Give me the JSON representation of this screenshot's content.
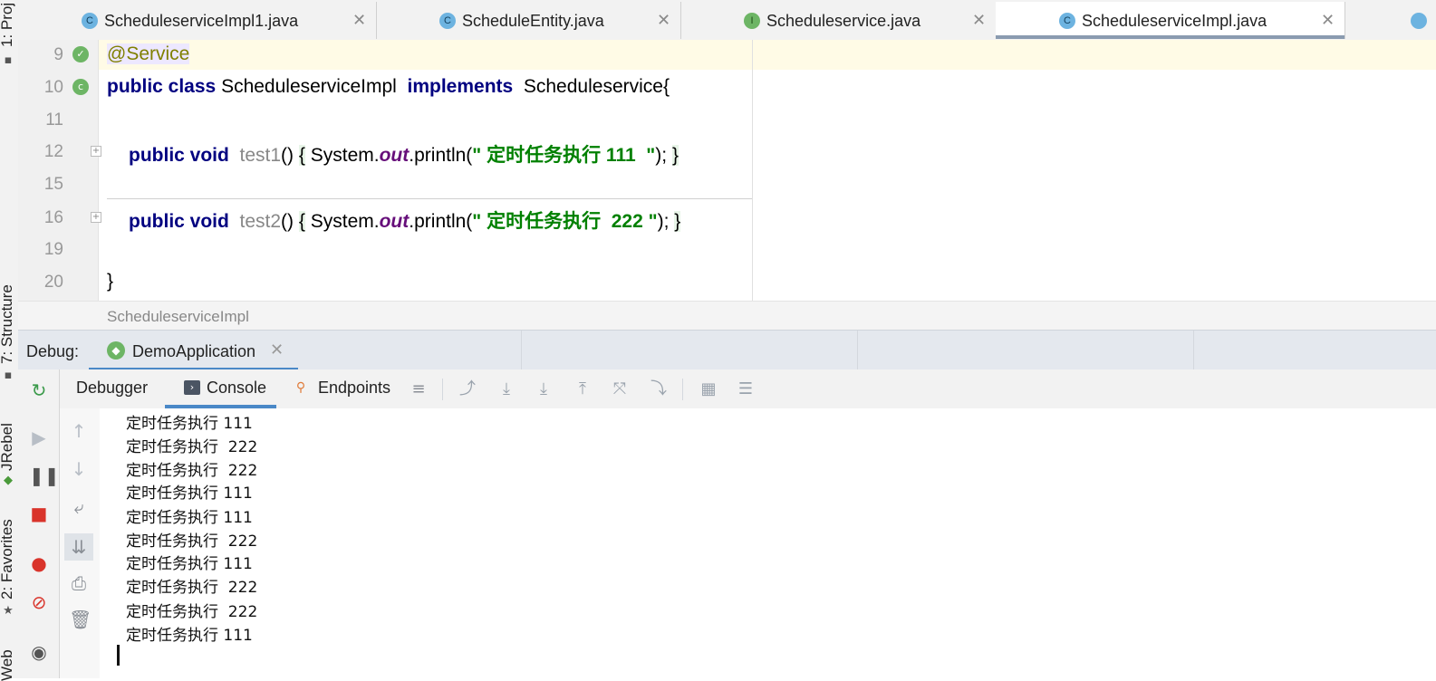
{
  "left_strip": {
    "labels": [
      "1: Proj",
      "7: Structure",
      "JRebel",
      "2: Favorites",
      "Web"
    ]
  },
  "tabs": [
    {
      "label": "ScheduleserviceImpl1.java",
      "icon": "class-icon",
      "icon_letter": "C",
      "active": false
    },
    {
      "label": "ScheduleEntity.java",
      "icon": "class-icon",
      "icon_letter": "C",
      "active": false
    },
    {
      "label": "Scheduleservice.java",
      "icon": "interface-icon",
      "icon_letter": "I",
      "active": false
    },
    {
      "label": "ScheduleserviceImpl.java",
      "icon": "class-icon",
      "icon_letter": "C",
      "active": true
    }
  ],
  "tab_close_glyph": "✕",
  "editor": {
    "line_numbers": [
      "9",
      "10",
      "11",
      "12",
      "15",
      "16",
      "19",
      "20"
    ],
    "code": {
      "l9_annotation": "@Service",
      "l10_kw": "public class",
      "l10_name": "ScheduleserviceImpl",
      "l10_implements": "implements",
      "l10_iface": "Scheduleservice{",
      "l12_kw": "public void",
      "l12_method": "test1",
      "l12_parens": "()",
      "l12_open": "{",
      "l12_sys": "System.",
      "l12_out": "out",
      "l12_println": ".println(",
      "l12_str": "\" 定时任务执行 111  \"",
      "l12_end": ");",
      "l12_close": "}",
      "l16_kw": "public void",
      "l16_method": "test2",
      "l16_parens": "()",
      "l16_open": "{",
      "l16_sys": "System.",
      "l16_out": "out",
      "l16_println": ".println(",
      "l16_str": "\" 定时任务执行  222 \"",
      "l16_end": ");",
      "l16_close": "}",
      "l20_brace": "}"
    }
  },
  "breadcrumb": "ScheduleserviceImpl",
  "debug": {
    "title": "Debug:",
    "run_config": "DemoApplication",
    "tabs": {
      "debugger": "Debugger",
      "console": "Console",
      "endpoints": "Endpoints"
    }
  },
  "console_output": [
    "定时任务执行 111",
    "定时任务执行  222",
    "定时任务执行  222",
    "定时任务执行 111",
    "定时任务执行 111",
    "定时任务执行  222",
    "定时任务执行 111",
    "定时任务执行  222",
    "定时任务执行  222",
    "定时任务执行 111"
  ],
  "colors": {
    "keyword": "#000080",
    "annotation": "#808000",
    "string": "#008000",
    "static_field": "#660e7a",
    "active_underline": "#4a88c7"
  }
}
